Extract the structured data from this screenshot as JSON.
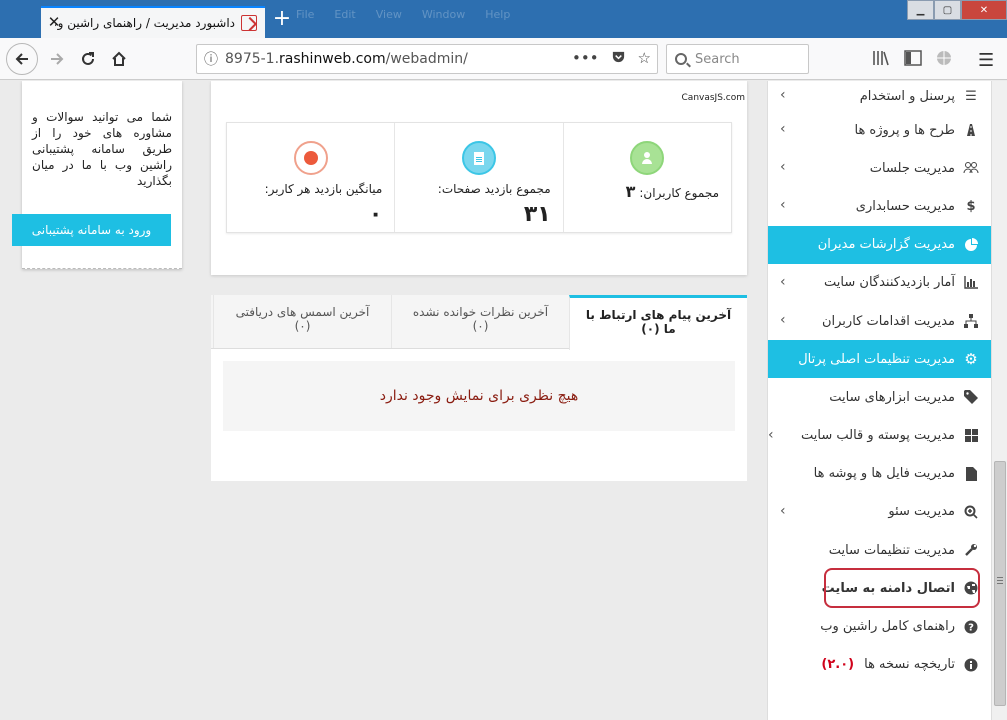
{
  "browser": {
    "tab_title": "داشبورد مدیریت / راهنمای راشین وب",
    "url_prefix": "8975-1.",
    "url_domain": "rashinweb.com",
    "url_path": "/webadmin/",
    "search_placeholder": "Search",
    "ghost_menu": [
      "File",
      "Edit",
      "View",
      "Window",
      "Help"
    ]
  },
  "support": {
    "text": "شما می توانید سوالات و مشاوره های خود را از طریق سامانه پشتیبانی راشین وب با ما در میان بگذارید",
    "button_label": "ورود به سامانه پشتیبانی"
  },
  "stats": {
    "credit": "CanvasJS.com",
    "items": [
      {
        "label": "مجموع کاربران:",
        "value": "۳"
      },
      {
        "label": "مجموع بازدید صفحات:",
        "value": "۳۱"
      },
      {
        "label": "میانگین بازدید هر کاربر:",
        "value": "۰"
      }
    ]
  },
  "tabs": {
    "items": [
      {
        "label": "آخرین پیام های ارتباط با ما",
        "count": "(۰)"
      },
      {
        "label": "آخرین نظرات خوانده نشده",
        "count": "(۰)"
      },
      {
        "label": "آخرین اسمس های دریافتی",
        "count": "(۰)"
      }
    ],
    "empty_message": "هیچ نظری برای نمایش وجود ندارد"
  },
  "sidebar": {
    "items": [
      {
        "label": "پرسنل و استخدام",
        "icon": "list-icon"
      },
      {
        "label": "طرح ها و پروژه ها",
        "icon": "road-icon"
      },
      {
        "label": "مدیریت جلسات",
        "icon": "group-icon"
      },
      {
        "label": "مدیریت حسابداری",
        "icon": "dollar-icon"
      },
      {
        "label": "مدیریت گزارشات مدیران",
        "icon": "pie-chart-icon"
      },
      {
        "label": "آمار بازدیدکنندگان سایت",
        "icon": "bar-chart-icon"
      },
      {
        "label": "مدیریت اقدامات کاربران",
        "icon": "sitemap-icon"
      },
      {
        "label": "مدیریت تنظیمات اصلی پرتال",
        "icon": "gear-icon"
      },
      {
        "label": "مدیریت ابزارهای سایت",
        "icon": "tag-icon"
      },
      {
        "label": "مدیریت پوسته و قالب سایت",
        "icon": "windows-icon"
      },
      {
        "label": "مدیریت فایل ها و پوشه ها",
        "icon": "file-icon"
      },
      {
        "label": "مدیریت سئو",
        "icon": "zoom-icon"
      },
      {
        "label": "مدیریت تنظیمات سایت",
        "icon": "wrench-icon"
      },
      {
        "label": "اتصال دامنه به سایت",
        "icon": "globe-icon"
      },
      {
        "label": "راهنمای کامل راشین وب",
        "icon": "question-icon"
      },
      {
        "label": "تاریخچه نسخه ها",
        "icon": "info-icon",
        "badge": "(۲.۰)"
      }
    ],
    "active_color": "#1ebfe3",
    "highlight_color": "#c62e3e"
  }
}
